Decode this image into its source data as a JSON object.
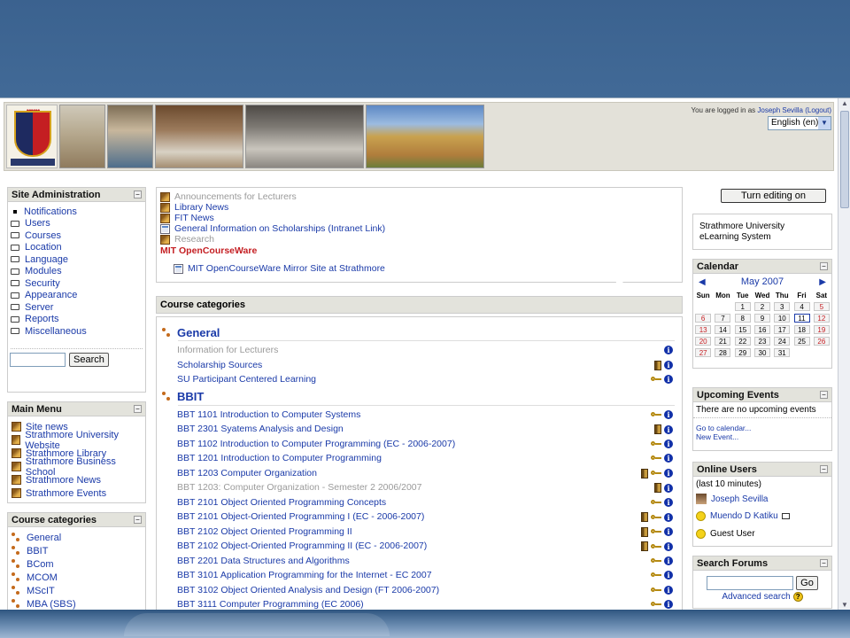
{
  "header": {
    "login_prefix": "You are logged in as",
    "login_user": "Joseph Sevilla",
    "logout_label": "(Logout)",
    "language": "English (en)"
  },
  "site_admin": {
    "title": "Site Administration",
    "items": [
      {
        "label": "Notifications",
        "icon": "bullet-icon"
      },
      {
        "label": "Users",
        "icon": "folder-icon"
      },
      {
        "label": "Courses",
        "icon": "folder-icon"
      },
      {
        "label": "Location",
        "icon": "folder-icon"
      },
      {
        "label": "Language",
        "icon": "folder-icon"
      },
      {
        "label": "Modules",
        "icon": "folder-icon"
      },
      {
        "label": "Security",
        "icon": "folder-icon"
      },
      {
        "label": "Appearance",
        "icon": "folder-icon"
      },
      {
        "label": "Server",
        "icon": "folder-icon"
      },
      {
        "label": "Reports",
        "icon": "folder-icon"
      },
      {
        "label": "Miscellaneous",
        "icon": "folder-icon"
      }
    ],
    "search_label": "Search"
  },
  "main_menu": {
    "title": "Main Menu",
    "items": [
      "Site news",
      "Strathmore University Website",
      "Strathmore Library",
      "Strathmore Business School",
      "Strathmore News",
      "Strathmore Events"
    ]
  },
  "course_categories_block": {
    "title": "Course categories",
    "items": [
      "General",
      "BBIT",
      "BCom",
      "MCOM",
      "MScIT",
      "MBA (SBS)"
    ]
  },
  "center_top": {
    "items": [
      {
        "label": "Announcements for Lecturers",
        "dim": true,
        "icon": "forum-icon"
      },
      {
        "label": "Library News",
        "dim": false,
        "icon": "forum-icon"
      },
      {
        "label": "FIT News",
        "dim": false,
        "icon": "forum-icon"
      },
      {
        "label": "General Information on Scholarships (Intranet Link)",
        "dim": false,
        "icon": "resource-icon"
      },
      {
        "label": "Research",
        "dim": true,
        "icon": "forum-icon"
      }
    ],
    "section_title": "MIT OpenCourseWare",
    "section_item": "MIT OpenCourseWare Mirror Site at Strathmore"
  },
  "course_categories": {
    "title": "Course categories",
    "general": {
      "name": "General",
      "courses": [
        {
          "label": "Information for Lecturers",
          "dim": true,
          "key": false,
          "door": false
        },
        {
          "label": "Scholarship Sources",
          "dim": false,
          "key": false,
          "door": true
        },
        {
          "label": "SU Participant Centered Learning",
          "dim": false,
          "key": true,
          "door": false
        }
      ]
    },
    "bbit": {
      "name": "BBIT",
      "courses": [
        {
          "label": "BBT 1101 Introduction to Computer Systems",
          "dim": false,
          "key": true,
          "door": false
        },
        {
          "label": "BBT 2301 Syatems Analysis and Design",
          "dim": false,
          "key": false,
          "door": true
        },
        {
          "label": "BBT 1102 Introduction to Computer Programming (EC - 2006-2007)",
          "dim": false,
          "key": true,
          "door": false
        },
        {
          "label": "BBT 1201 Introduction to Computer Programming",
          "dim": false,
          "key": true,
          "door": false
        },
        {
          "label": "BBT 1203 Computer Organization",
          "dim": false,
          "key": true,
          "door": true
        },
        {
          "label": "BBT 1203: Computer Organization - Semester 2 2006/2007",
          "dim": true,
          "key": false,
          "door": true
        },
        {
          "label": "BBT 2101 Object Oriented Programming Concepts",
          "dim": false,
          "key": true,
          "door": false
        },
        {
          "label": "BBT 2101 Object-Oriented Programming I (EC - 2006-2007)",
          "dim": false,
          "key": true,
          "door": true
        },
        {
          "label": "BBT 2102 Object Oriented Programming II",
          "dim": false,
          "key": true,
          "door": true
        },
        {
          "label": "BBT 2102 Object-Oriented Programming II (EC - 2006-2007)",
          "dim": false,
          "key": true,
          "door": true
        },
        {
          "label": "BBT 2201 Data Structures and Algorithms",
          "dim": false,
          "key": true,
          "door": false
        },
        {
          "label": "BBT 3101 Application Programming for the Internet - EC 2007",
          "dim": false,
          "key": true,
          "door": false
        },
        {
          "label": "BBT 3102 Object Oriented Analysis and Design (FT 2006-2007)",
          "dim": false,
          "key": true,
          "door": false
        },
        {
          "label": "BBT 3111 Computer Programming (EC 2006)",
          "dim": false,
          "key": true,
          "door": false
        }
      ]
    }
  },
  "right": {
    "turn_editing": "Turn editing on",
    "site_description": "Strathmore University eLearning System",
    "calendar": {
      "title": "Calendar",
      "month": "May 2007",
      "weekdays": [
        "Sun",
        "Mon",
        "Tue",
        "Wed",
        "Thu",
        "Fri",
        "Sat"
      ],
      "today": 11,
      "weeks": [
        [
          "",
          "",
          "1",
          "2",
          "3",
          "4",
          "5"
        ],
        [
          "6",
          "7",
          "8",
          "9",
          "10",
          "11",
          "12"
        ],
        [
          "13",
          "14",
          "15",
          "16",
          "17",
          "18",
          "19"
        ],
        [
          "20",
          "21",
          "22",
          "23",
          "24",
          "25",
          "26"
        ],
        [
          "27",
          "28",
          "29",
          "30",
          "31",
          "",
          ""
        ]
      ]
    },
    "upcoming": {
      "title": "Upcoming Events",
      "text": "There are no upcoming events",
      "goto_calendar": "Go to calendar...",
      "new_event": "New Event..."
    },
    "online": {
      "title": "Online Users",
      "subtitle": "(last 10 minutes)",
      "users": [
        "Joseph Sevilla",
        "Muendo D Katiku",
        "Guest User"
      ]
    },
    "search_forums": {
      "title": "Search Forums",
      "go_label": "Go",
      "advanced": "Advanced search"
    }
  }
}
